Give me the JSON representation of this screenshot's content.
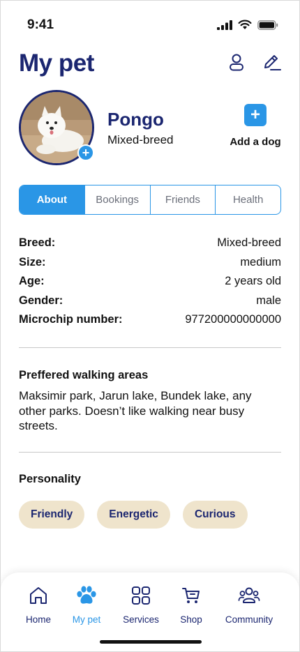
{
  "status_bar": {
    "time": "9:41"
  },
  "header": {
    "title": "My pet"
  },
  "pet": {
    "name": "Pongo",
    "breed_short": "Mixed-breed",
    "add_photo": "+"
  },
  "add_dog": {
    "icon": "+",
    "label": "Add a dog"
  },
  "tabs": [
    {
      "label": "About",
      "active": true
    },
    {
      "label": "Bookings",
      "active": false
    },
    {
      "label": "Friends",
      "active": false
    },
    {
      "label": "Health",
      "active": false
    }
  ],
  "details": [
    {
      "key": "Breed:",
      "value": "Mixed-breed"
    },
    {
      "key": "Size:",
      "value": "medium"
    },
    {
      "key": "Age:",
      "value": "2 years old"
    },
    {
      "key": "Gender:",
      "value": "male"
    },
    {
      "key": "Microchip number:",
      "value": "977200000000000"
    }
  ],
  "walking": {
    "title": "Preffered walking areas",
    "text": "Maksimir park, Jarun lake, Bundek lake, any other parks. Doesn’t like walking near busy streets."
  },
  "personality": {
    "title": "Personality",
    "traits": [
      "Friendly",
      "Energetic",
      "Curious"
    ]
  },
  "nav": [
    {
      "label": "Home",
      "icon": "home-icon",
      "active": false
    },
    {
      "label": "My pet",
      "icon": "paw-icon",
      "active": true
    },
    {
      "label": "Services",
      "icon": "grid-icon",
      "active": false
    },
    {
      "label": "Shop",
      "icon": "cart-icon",
      "active": false
    },
    {
      "label": "Community",
      "icon": "community-icon",
      "active": false
    }
  ],
  "colors": {
    "primary_navy": "#1b2670",
    "accent_blue": "#2a96e6",
    "chip_beige": "#efe4cc",
    "divider": "#c8c8c8"
  }
}
